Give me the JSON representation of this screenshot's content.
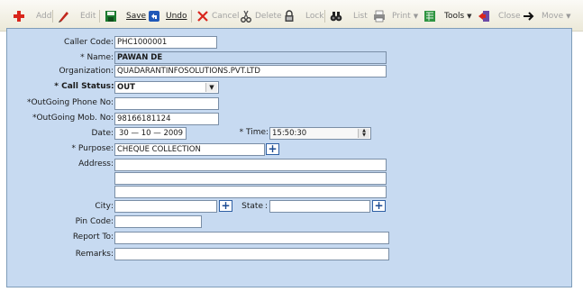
{
  "toolbar": {
    "add": "Add",
    "edit": "Edit",
    "save": "Save",
    "undo": "Undo",
    "cancel": "Cancel",
    "delete": "Delete",
    "lock": "Lock",
    "list": "List",
    "print": "Print",
    "tools": "Tools",
    "close": "Close",
    "move": "Move"
  },
  "form": {
    "caller_code": {
      "label": "Caller Code",
      "value": "PHC1000001"
    },
    "name": {
      "label": "* Name",
      "value": "PAWAN DE"
    },
    "organization": {
      "label": "Organization",
      "value": "QUADARANTINFOSOLUTIONS.PVT.LTD"
    },
    "call_status": {
      "label": "* Call Status",
      "value": "OUT"
    },
    "outgoing_phone": {
      "label": "*OutGoing Phone No",
      "value": ""
    },
    "outgoing_mobile": {
      "label": "*OutGoing Mob. No",
      "value": "98166181124"
    },
    "date": {
      "label": "Date",
      "value": "30 — 10 — 2009"
    },
    "time": {
      "label": "* Time",
      "value": "15:50:30"
    },
    "purpose": {
      "label": "* Purpose",
      "value": "CHEQUE COLLECTION"
    },
    "address": {
      "label": "Address",
      "line1": "",
      "line2": "",
      "line3": ""
    },
    "city": {
      "label": "City",
      "value": ""
    },
    "state": {
      "label": "State",
      "value": ""
    },
    "pin_code": {
      "label": "Pin Code",
      "value": ""
    },
    "report_to": {
      "label": "Report To",
      "value": ""
    },
    "remarks": {
      "label": "Remarks",
      "value": ""
    }
  },
  "colon": ":",
  "plus_symbol": "+",
  "colors": {
    "panel_bg": "#c7daf1",
    "highlight": "#c3d7ef",
    "add_icon": "#d9261c"
  }
}
